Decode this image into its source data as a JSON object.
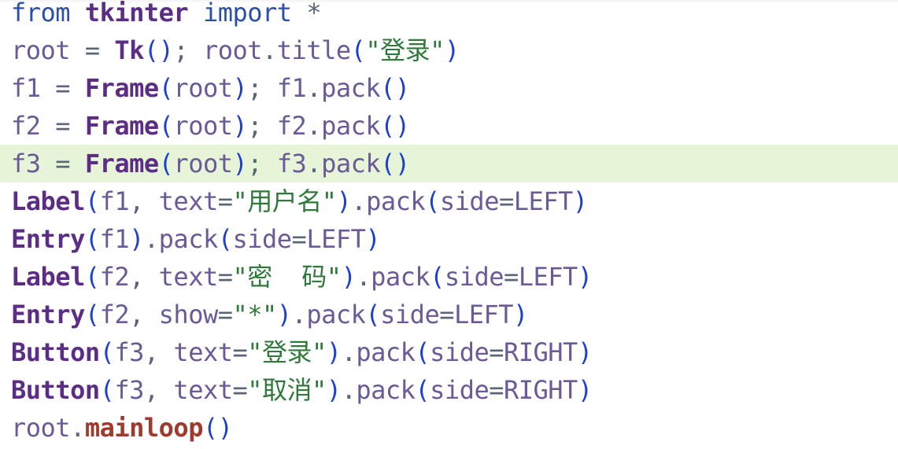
{
  "editor": {
    "lines": [
      [
        {
          "t": "from",
          "c": "kw"
        },
        {
          "t": " ",
          "c": "op"
        },
        {
          "t": "tkinter",
          "c": "mod"
        },
        {
          "t": " ",
          "c": "op"
        },
        {
          "t": "import",
          "c": "kw"
        },
        {
          "t": " *",
          "c": "op"
        }
      ],
      [
        {
          "t": "root",
          "c": "name"
        },
        {
          "t": " = ",
          "c": "op"
        },
        {
          "t": "Tk",
          "c": "mod"
        },
        {
          "t": "()",
          "c": "paren"
        },
        {
          "t": "; ",
          "c": "op"
        },
        {
          "t": "root",
          "c": "name"
        },
        {
          "t": ".",
          "c": "op"
        },
        {
          "t": "title",
          "c": "method"
        },
        {
          "t": "(",
          "c": "paren"
        },
        {
          "t": "\"登录\"",
          "c": "str"
        },
        {
          "t": ")",
          "c": "paren"
        }
      ],
      [
        {
          "t": "f1",
          "c": "name"
        },
        {
          "t": " = ",
          "c": "op"
        },
        {
          "t": "Frame",
          "c": "mod"
        },
        {
          "t": "(",
          "c": "paren"
        },
        {
          "t": "root",
          "c": "name"
        },
        {
          "t": ")",
          "c": "paren"
        },
        {
          "t": "; ",
          "c": "op"
        },
        {
          "t": "f1",
          "c": "name"
        },
        {
          "t": ".",
          "c": "op"
        },
        {
          "t": "pack",
          "c": "method"
        },
        {
          "t": "()",
          "c": "paren"
        }
      ],
      [
        {
          "t": "f2",
          "c": "name"
        },
        {
          "t": " = ",
          "c": "op"
        },
        {
          "t": "Frame",
          "c": "mod"
        },
        {
          "t": "(",
          "c": "paren"
        },
        {
          "t": "root",
          "c": "name"
        },
        {
          "t": ")",
          "c": "paren"
        },
        {
          "t": "; ",
          "c": "op"
        },
        {
          "t": "f2",
          "c": "name"
        },
        {
          "t": ".",
          "c": "op"
        },
        {
          "t": "pack",
          "c": "method"
        },
        {
          "t": "()",
          "c": "paren"
        }
      ],
      [
        {
          "t": "f3",
          "c": "name"
        },
        {
          "t": " = ",
          "c": "op"
        },
        {
          "t": "Frame",
          "c": "mod"
        },
        {
          "t": "(",
          "c": "paren"
        },
        {
          "t": "root",
          "c": "name"
        },
        {
          "t": ")",
          "c": "paren"
        },
        {
          "t": "; ",
          "c": "op"
        },
        {
          "t": "f3",
          "c": "name"
        },
        {
          "t": ".",
          "c": "op"
        },
        {
          "t": "pack",
          "c": "method"
        },
        {
          "t": "()",
          "c": "paren"
        }
      ],
      [
        {
          "t": "Label",
          "c": "mod"
        },
        {
          "t": "(",
          "c": "paren"
        },
        {
          "t": "f1",
          "c": "name"
        },
        {
          "t": ", ",
          "c": "op"
        },
        {
          "t": "text",
          "c": "name"
        },
        {
          "t": "=",
          "c": "op"
        },
        {
          "t": "\"用户名\"",
          "c": "str"
        },
        {
          "t": ")",
          "c": "paren"
        },
        {
          "t": ".",
          "c": "op"
        },
        {
          "t": "pack",
          "c": "method"
        },
        {
          "t": "(",
          "c": "paren"
        },
        {
          "t": "side",
          "c": "name"
        },
        {
          "t": "=",
          "c": "op"
        },
        {
          "t": "LEFT",
          "c": "const"
        },
        {
          "t": ")",
          "c": "paren"
        }
      ],
      [
        {
          "t": "Entry",
          "c": "mod"
        },
        {
          "t": "(",
          "c": "paren"
        },
        {
          "t": "f1",
          "c": "name"
        },
        {
          "t": ")",
          "c": "paren"
        },
        {
          "t": ".",
          "c": "op"
        },
        {
          "t": "pack",
          "c": "method"
        },
        {
          "t": "(",
          "c": "paren"
        },
        {
          "t": "side",
          "c": "name"
        },
        {
          "t": "=",
          "c": "op"
        },
        {
          "t": "LEFT",
          "c": "const"
        },
        {
          "t": ")",
          "c": "paren"
        }
      ],
      [
        {
          "t": "Label",
          "c": "mod"
        },
        {
          "t": "(",
          "c": "paren"
        },
        {
          "t": "f2",
          "c": "name"
        },
        {
          "t": ", ",
          "c": "op"
        },
        {
          "t": "text",
          "c": "name"
        },
        {
          "t": "=",
          "c": "op"
        },
        {
          "t": "\"密  码\"",
          "c": "str"
        },
        {
          "t": ")",
          "c": "paren"
        },
        {
          "t": ".",
          "c": "op"
        },
        {
          "t": "pack",
          "c": "method"
        },
        {
          "t": "(",
          "c": "paren"
        },
        {
          "t": "side",
          "c": "name"
        },
        {
          "t": "=",
          "c": "op"
        },
        {
          "t": "LEFT",
          "c": "const"
        },
        {
          "t": ")",
          "c": "paren"
        }
      ],
      [
        {
          "t": "Entry",
          "c": "mod"
        },
        {
          "t": "(",
          "c": "paren"
        },
        {
          "t": "f2",
          "c": "name"
        },
        {
          "t": ", ",
          "c": "op"
        },
        {
          "t": "show",
          "c": "name"
        },
        {
          "t": "=",
          "c": "op"
        },
        {
          "t": "\"*\"",
          "c": "str"
        },
        {
          "t": ")",
          "c": "paren"
        },
        {
          "t": ".",
          "c": "op"
        },
        {
          "t": "pack",
          "c": "method"
        },
        {
          "t": "(",
          "c": "paren"
        },
        {
          "t": "side",
          "c": "name"
        },
        {
          "t": "=",
          "c": "op"
        },
        {
          "t": "LEFT",
          "c": "const"
        },
        {
          "t": ")",
          "c": "paren"
        }
      ],
      [
        {
          "t": "Button",
          "c": "mod"
        },
        {
          "t": "(",
          "c": "paren"
        },
        {
          "t": "f3",
          "c": "name"
        },
        {
          "t": ", ",
          "c": "op"
        },
        {
          "t": "text",
          "c": "name"
        },
        {
          "t": "=",
          "c": "op"
        },
        {
          "t": "\"登录\"",
          "c": "str"
        },
        {
          "t": ")",
          "c": "paren"
        },
        {
          "t": ".",
          "c": "op"
        },
        {
          "t": "pack",
          "c": "method"
        },
        {
          "t": "(",
          "c": "paren"
        },
        {
          "t": "side",
          "c": "name"
        },
        {
          "t": "=",
          "c": "op"
        },
        {
          "t": "RIGHT",
          "c": "const"
        },
        {
          "t": ")",
          "c": "paren"
        }
      ],
      [
        {
          "t": "Button",
          "c": "mod"
        },
        {
          "t": "(",
          "c": "paren"
        },
        {
          "t": "f3",
          "c": "name"
        },
        {
          "t": ", ",
          "c": "op"
        },
        {
          "t": "text",
          "c": "name"
        },
        {
          "t": "=",
          "c": "op"
        },
        {
          "t": "\"取消\"",
          "c": "str"
        },
        {
          "t": ")",
          "c": "paren"
        },
        {
          "t": ".",
          "c": "op"
        },
        {
          "t": "pack",
          "c": "method"
        },
        {
          "t": "(",
          "c": "paren"
        },
        {
          "t": "side",
          "c": "name"
        },
        {
          "t": "=",
          "c": "op"
        },
        {
          "t": "RIGHT",
          "c": "const"
        },
        {
          "t": ")",
          "c": "paren"
        }
      ],
      [
        {
          "t": "root",
          "c": "name"
        },
        {
          "t": ".",
          "c": "op"
        },
        {
          "t": "mainloop",
          "c": "builtin"
        },
        {
          "t": "()",
          "c": "paren"
        }
      ]
    ],
    "highlighted_line": 5
  },
  "colors": {
    "highlight_background": "#e6f5d7",
    "keyword": "#2c4fa6",
    "class_name": "#5b2d85",
    "string": "#2f7a3b",
    "builtin_method": "#9f3a2e",
    "paren": "#1f3fd0"
  }
}
